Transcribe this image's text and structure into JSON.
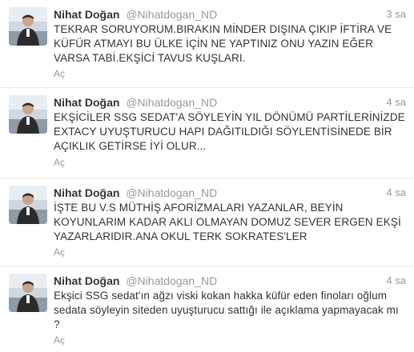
{
  "tweets": [
    {
      "name": "Nihat Doğan",
      "handle": "@Nihatdogan_ND",
      "time": "3 sa",
      "text": "TEKRAR SORUYORUM.BIRAKIN MİNDER DIŞINA ÇIKIP İFTİRA VE KÜFÜR ATMAYI BU ÜLKE İÇİN NE YAPTINIZ ONU YAZIN EĞER VARSA TABİ.EKŞİCİ TAVUS KUŞLARI.",
      "expand": "Aç"
    },
    {
      "name": "Nihat Doğan",
      "handle": "@Nihatdogan_ND",
      "time": "4 sa",
      "text": "EKŞİCİLER SSG SEDAT'A SÖYLEYİN YIL DÖNÜMÜ PARTİLERİNİZDE EXTACY UYUŞTURUCU HAPI DAĞITILDIĞI SÖYLENTİSİNEDE BİR AÇIKLIK GETİRSE İYİ OLUR...",
      "expand": "Aç"
    },
    {
      "name": "Nihat Doğan",
      "handle": "@Nihatdogan_ND",
      "time": "4 sa",
      "text": "İŞTE BU V.S MÜTHİŞ AFORİZMALARI YAZANLAR, BEYİN KOYUNLARIM KADAR AKLI OLMAYAN DOMUZ SEVER ERGEN EKŞİ YAZARLARIDIR.ANA OKUL TERK SOKRATES'LER",
      "expand": "Aç"
    },
    {
      "name": "Nihat Doğan",
      "handle": "@Nihatdogan_ND",
      "time": "4 sa",
      "text": "Ekşici SSG sedat'ın ağzı viski kokan hakka küfür eden finoları oğlum sedata söyleyin siteden uyuşturucu sattığı ile açıklama yapmayacak mı ?",
      "expand": "Aç"
    }
  ]
}
